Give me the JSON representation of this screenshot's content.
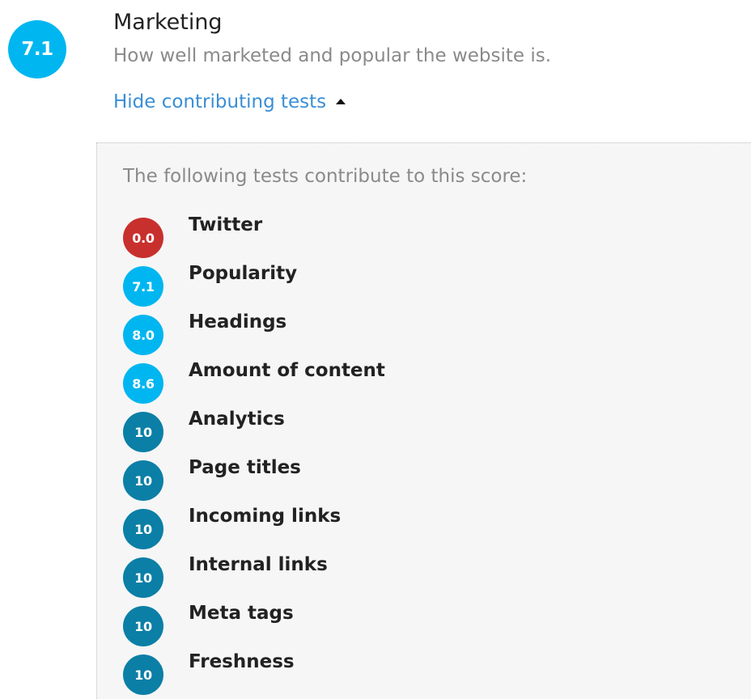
{
  "section": {
    "score": "7.1",
    "score_color": "#00b6f0",
    "title": "Marketing",
    "description": "How well marketed and popular the website is.",
    "toggle_label": "Hide contributing tests",
    "toggle_icon": "caret-up-icon"
  },
  "panel": {
    "intro": "The following tests contribute to this score:",
    "tests": [
      {
        "score": "0.0",
        "name": "Twitter",
        "color": "#c8302d"
      },
      {
        "score": "7.1",
        "name": "Popularity",
        "color": "#00b6f0"
      },
      {
        "score": "8.0",
        "name": "Headings",
        "color": "#00b6f0"
      },
      {
        "score": "8.6",
        "name": "Amount of content",
        "color": "#00b6f0"
      },
      {
        "score": "10",
        "name": "Analytics",
        "color": "#0b7fa6"
      },
      {
        "score": "10",
        "name": "Page titles",
        "color": "#0b7fa6"
      },
      {
        "score": "10",
        "name": "Incoming links",
        "color": "#0b7fa6"
      },
      {
        "score": "10",
        "name": "Internal links",
        "color": "#0b7fa6"
      },
      {
        "score": "10",
        "name": "Meta tags",
        "color": "#0b7fa6"
      },
      {
        "score": "10",
        "name": "Freshness",
        "color": "#0b7fa6"
      }
    ]
  }
}
